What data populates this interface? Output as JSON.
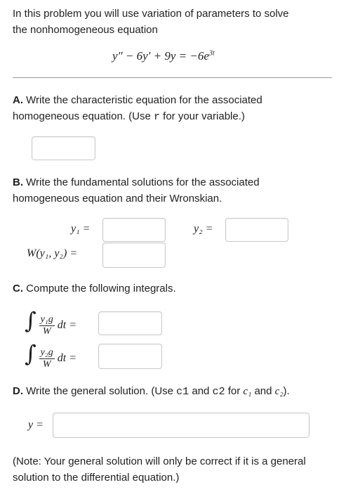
{
  "intro": {
    "line1": "In this problem you will use variation of parameters to solve",
    "line2": "the nonhomogeneous equation",
    "equation": "y″ − 6y′ + 9y = −6e",
    "equation_exp": "3t"
  },
  "part_a": {
    "label": "A.",
    "text1": " Write the characteristic equation for the associated",
    "text2": "homogeneous equation. (Use ",
    "var": "r",
    "text3": " for your variable.)"
  },
  "part_b": {
    "label": "B.",
    "text1": " Write the fundamental solutions for the associated",
    "text2": "homogeneous equation and their Wronskian.",
    "y1_label": "y₁ =",
    "y2_label": "y₂ =",
    "w_label": "W(y₁, y₂) ="
  },
  "part_c": {
    "label": "C.",
    "text1": " Compute the following integrals.",
    "int1_num": "y₁g",
    "int2_num": "y₂g",
    "den": "W",
    "dt": "dt ="
  },
  "part_d": {
    "label": "D.",
    "text1": " Write the general solution. (Use ",
    "c1": "c1",
    "text2": " and ",
    "c2": "c2",
    "text3": " for ",
    "c1_math": "c₁",
    "text4": " and ",
    "c2_math": "c₂",
    "text5": ").",
    "y_label": "y ="
  },
  "note": {
    "line1": "(Note: Your general solution will only be correct if it is a general",
    "line2": "solution to the differential equation.)"
  }
}
